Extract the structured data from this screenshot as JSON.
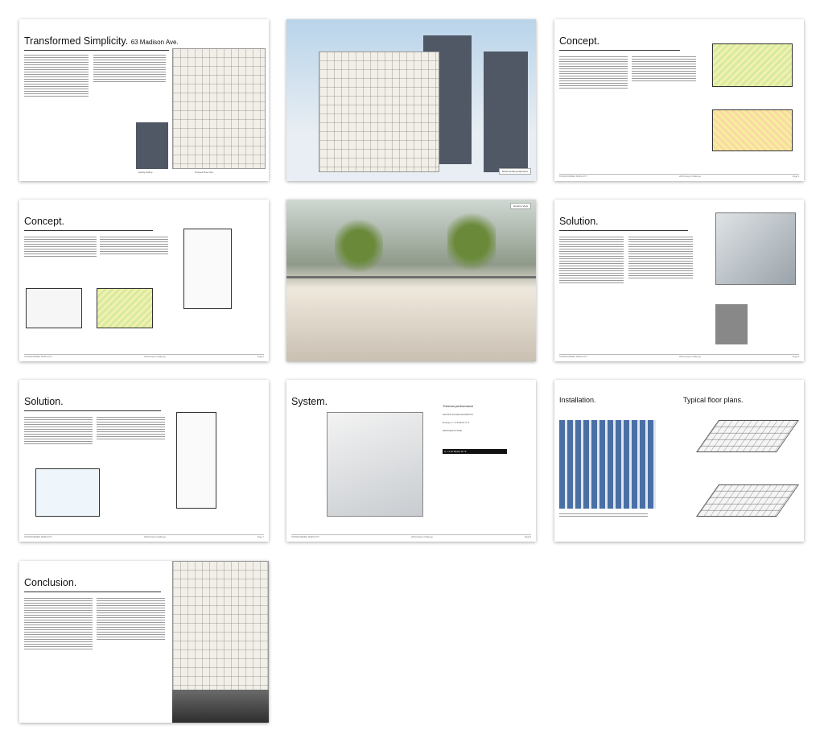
{
  "pages": [
    {
      "title": "Transformed Simplicity.",
      "subtitle": "63 Madison Ave.",
      "captions": [
        "Existing building",
        "Proposed Street View"
      ]
    },
    {
      "caption": "Roofs aerial perspective"
    },
    {
      "title": "Concept.",
      "footer": [
        "TRANSFORMED SIMPLICITY",
        "2020 Design Challenge",
        "Page 3"
      ]
    },
    {
      "title": "Concept.",
      "footer": [
        "TRANSFORMED SIMPLICITY",
        "2020 Design Challenge",
        "Page 4"
      ]
    },
    {
      "caption": "Exterior View"
    },
    {
      "title": "Solution.",
      "footer": [
        "TRANSFORMED SIMPLICITY",
        "2020 Design Challenge",
        "Page 6"
      ]
    },
    {
      "title": "Solution.",
      "footer": [
        "TRANSFORMED SIMPLICITY",
        "2020 Design Challenge",
        "Page 7"
      ]
    },
    {
      "title": "System.",
      "thermo": {
        "heading": "Thermal performance",
        "line1": "EXISTING FACADE ASSUMPTION",
        "line2": "Envelope: U = 0.90 Btu/hr ft² °F",
        "line3": "PROPOSED SYSTEM",
        "boxed": "U = 0.27 Btu/hr ft² °F"
      },
      "footer": [
        "TRANSFORMED SIMPLICITY",
        "2020 Design Challenge",
        "Page 8"
      ]
    },
    {
      "title_left": "Installation.",
      "title_right": "Typical floor plans."
    },
    {
      "title": "Conclusion."
    }
  ]
}
